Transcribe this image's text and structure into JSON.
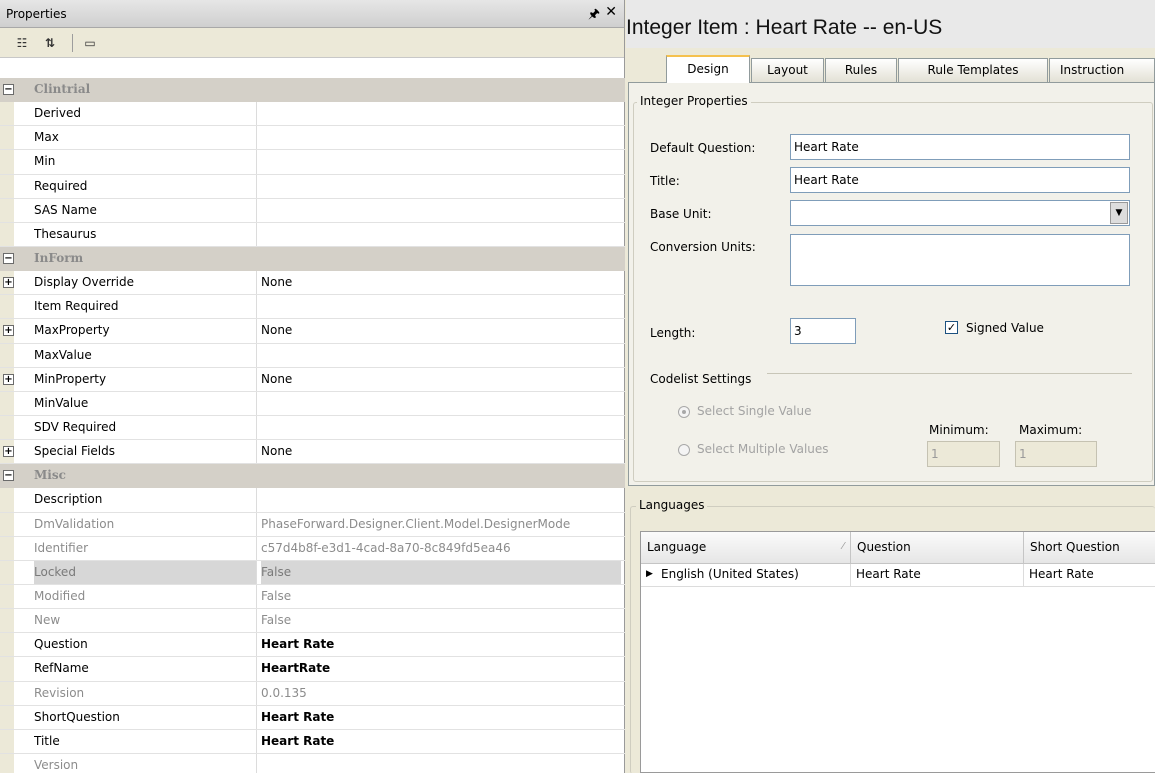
{
  "properties_panel": {
    "title": "Properties",
    "pin_glyph": "p",
    "close_glyph": "×",
    "categories": {
      "clintrial": "Clintrial",
      "inform": "InForm",
      "misc": "Misc"
    },
    "rows": {
      "derived": {
        "name": "Derived",
        "value": ""
      },
      "max": {
        "name": "Max",
        "value": ""
      },
      "min": {
        "name": "Min",
        "value": ""
      },
      "required": {
        "name": "Required",
        "value": ""
      },
      "sas_name": {
        "name": "SAS Name",
        "value": ""
      },
      "thesaurus": {
        "name": "Thesaurus",
        "value": ""
      },
      "display_override": {
        "name": "Display Override",
        "value": "None"
      },
      "item_required": {
        "name": "Item Required",
        "value": ""
      },
      "max_property": {
        "name": "MaxProperty",
        "value": "None"
      },
      "max_value": {
        "name": "MaxValue",
        "value": ""
      },
      "min_property": {
        "name": "MinProperty",
        "value": "None"
      },
      "min_value": {
        "name": "MinValue",
        "value": ""
      },
      "sdv_required": {
        "name": "SDV Required",
        "value": ""
      },
      "special_fields": {
        "name": "Special Fields",
        "value": "None"
      },
      "description": {
        "name": "Description",
        "value": ""
      },
      "dm_validation": {
        "name": "DmValidation",
        "value": "PhaseForward.Designer.Client.Model.DesignerMode"
      },
      "identifier": {
        "name": "Identifier",
        "value": "c57d4b8f-e3d1-4cad-8a70-8c849fd5ea46"
      },
      "locked": {
        "name": "Locked",
        "value": "False"
      },
      "modified": {
        "name": "Modified",
        "value": "False"
      },
      "new": {
        "name": "New",
        "value": "False"
      },
      "question": {
        "name": "Question",
        "value": "Heart Rate"
      },
      "ref_name": {
        "name": "RefName",
        "value": "HeartRate"
      },
      "revision": {
        "name": "Revision",
        "value": "0.0.135"
      },
      "short_question": {
        "name": "ShortQuestion",
        "value": "Heart Rate"
      },
      "title": {
        "name": "Title",
        "value": "Heart Rate"
      },
      "version": {
        "name": "Version",
        "value": ""
      }
    }
  },
  "designer": {
    "title": "Integer Item : Heart Rate -- en-US",
    "tabs": [
      "Design",
      "Layout",
      "Rules",
      "Rule Templates",
      "Instruction"
    ],
    "integer_properties": {
      "group_label": "Integer Properties",
      "default_question_label": "Default Question:",
      "default_question_value": "Heart Rate",
      "title_label": "Title:",
      "title_value": "Heart Rate",
      "base_unit_label": "Base Unit:",
      "base_unit_value": "",
      "conversion_units_label": "Conversion Units:",
      "conversion_units_value": "",
      "length_label": "Length:",
      "length_value": "3",
      "signed_value_label": "Signed Value",
      "signed_value_checked": true,
      "codelist_settings_label": "Codelist Settings",
      "select_single_label": "Select Single Value",
      "select_multiple_label": "Select Multiple Values",
      "minimum_label": "Minimum:",
      "minimum_value": "1",
      "maximum_label": "Maximum:",
      "maximum_value": "1"
    },
    "languages": {
      "group_label": "Languages",
      "columns": [
        "Language",
        "Question",
        "Short Question"
      ],
      "rows": [
        {
          "language": "English (United States)",
          "question": "Heart Rate",
          "short_question": "Heart Rate"
        }
      ]
    }
  }
}
